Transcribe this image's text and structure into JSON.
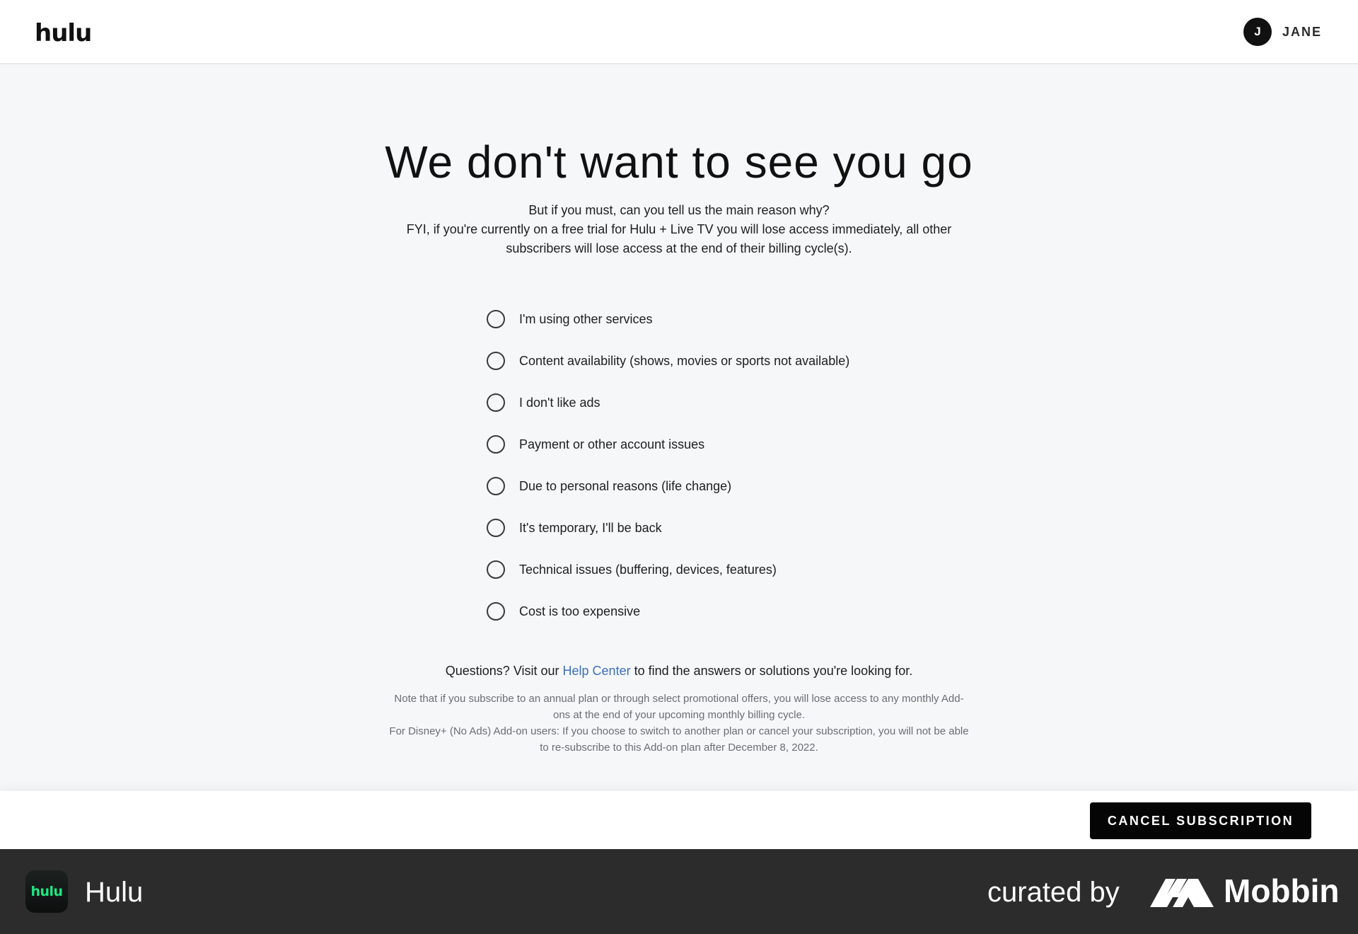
{
  "header": {
    "logo": "hulu",
    "profile": {
      "initial": "J",
      "name": "JANE"
    }
  },
  "main": {
    "title": "We don't want to see you go",
    "subtitle_line1": "But if you must, can you tell us the main reason why?",
    "subtitle_line2": "FYI, if you're currently on a free trial for Hulu + Live TV you will lose access immediately, all other subscribers will lose access at the end of their billing cycle(s).",
    "reasons": [
      "I'm using other services",
      "Content availability (shows, movies or sports not available)",
      "I don't like ads",
      "Payment or other account issues",
      "Due to personal reasons (life change)",
      "It's temporary, I'll be back",
      "Technical issues (buffering, devices, features)",
      "Cost is too expensive"
    ],
    "questions_prefix": "Questions? Visit our ",
    "help_link": "Help Center",
    "questions_suffix": " to find the answers or solutions you're looking for.",
    "note_line1": "Note that if you subscribe to an annual plan or through select promotional offers, you will lose access to any monthly Add-ons at the end of your upcoming monthly billing cycle.",
    "note_line2": "For Disney+ (No Ads) Add-on users: If you choose to switch to another plan or cancel your subscription, you will not be able to re-subscribe to this Add-on plan after December 8, 2022."
  },
  "action_bar": {
    "cancel_label": "CANCEL SUBSCRIPTION"
  },
  "footer": {
    "app_icon_text": "hulu",
    "app_name": "Hulu",
    "curated_by": "curated by",
    "brand": "Mobbin"
  },
  "colors": {
    "page_bg": "#f6f7f9",
    "link": "#3c6fbd",
    "button_bg": "#050505",
    "footer_bg": "#2c2c2d",
    "hulu_green": "#1ce783"
  }
}
